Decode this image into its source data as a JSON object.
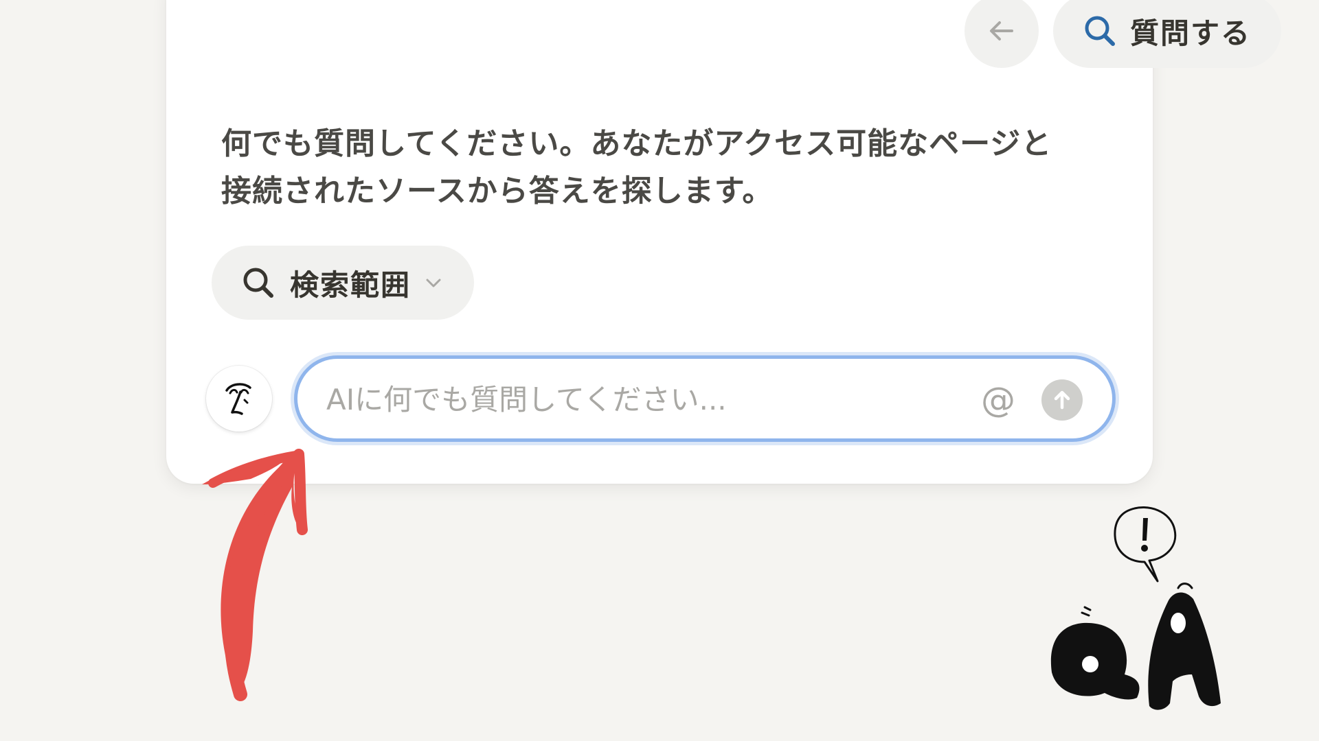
{
  "header": {
    "back_icon": "arrow-left-icon",
    "ask_button_label": "質問する",
    "ask_button_icon": "search-icon"
  },
  "intro_text": {
    "line1": "何でも質問してください。あなたがアクセス可能なページと",
    "line2": "接続されたソースから答えを探します。"
  },
  "scope": {
    "label": "検索範囲",
    "icon": "search-icon",
    "chevron": "chevron-down-icon"
  },
  "chat": {
    "avatar_icon": "ai-face-icon",
    "placeholder": "AIに何でも質問してください...",
    "value": "",
    "mention_symbol": "@",
    "send_icon": "arrow-up-icon"
  },
  "colors": {
    "background": "#f5f4f1",
    "card": "#ffffff",
    "pill": "#f1f1ef",
    "search_accent": "#2c6aa8",
    "input_focus": "#8fb5ec",
    "arrow": "#e5504a"
  },
  "decorations": {
    "arrow": "red-pointer-arrow",
    "illustration": "qa-exclamation-illustration"
  }
}
